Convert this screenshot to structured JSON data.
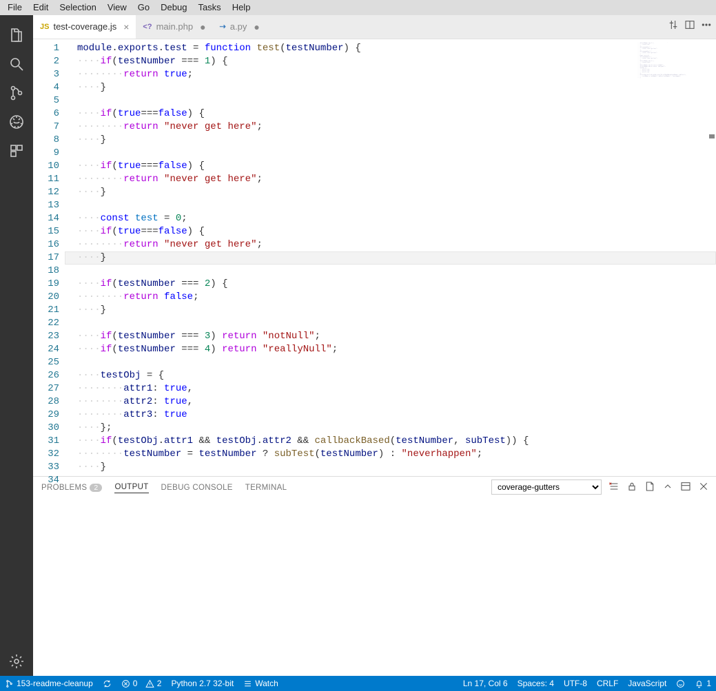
{
  "menu": {
    "items": [
      "File",
      "Edit",
      "Selection",
      "View",
      "Go",
      "Debug",
      "Tasks",
      "Help"
    ]
  },
  "tabs": [
    {
      "icon": "JS",
      "iconClass": "js",
      "label": "test-coverage.js",
      "active": true,
      "dirty": false
    },
    {
      "icon": "<?",
      "iconClass": "php",
      "label": "main.php",
      "active": false,
      "dirty": true
    },
    {
      "icon": "⇢",
      "iconClass": "py",
      "label": "a.py",
      "active": false,
      "dirty": true
    }
  ],
  "cursor_line": 17,
  "code_lines": [
    [
      {
        "t": "var",
        "s": "module"
      },
      {
        "t": "p",
        "s": "."
      },
      {
        "t": "prop",
        "s": "exports"
      },
      {
        "t": "p",
        "s": "."
      },
      {
        "t": "prop",
        "s": "test"
      },
      {
        "t": "p",
        "s": " = "
      },
      {
        "t": "kw",
        "s": "function"
      },
      {
        "t": "p",
        "s": " "
      },
      {
        "t": "fn",
        "s": "test"
      },
      {
        "t": "p",
        "s": "("
      },
      {
        "t": "var",
        "s": "testNumber"
      },
      {
        "t": "p",
        "s": ") {"
      }
    ],
    [
      {
        "t": "ws",
        "s": "····"
      },
      {
        "t": "kw2",
        "s": "if"
      },
      {
        "t": "p",
        "s": "("
      },
      {
        "t": "var",
        "s": "testNumber"
      },
      {
        "t": "p",
        "s": " === "
      },
      {
        "t": "num",
        "s": "1"
      },
      {
        "t": "p",
        "s": ") {"
      }
    ],
    [
      {
        "t": "ws",
        "s": "········"
      },
      {
        "t": "kw2",
        "s": "return"
      },
      {
        "t": "p",
        "s": " "
      },
      {
        "t": "kw",
        "s": "true"
      },
      {
        "t": "p",
        "s": ";"
      }
    ],
    [
      {
        "t": "ws",
        "s": "····"
      },
      {
        "t": "p",
        "s": "}"
      }
    ],
    [],
    [
      {
        "t": "ws",
        "s": "····"
      },
      {
        "t": "kw2",
        "s": "if"
      },
      {
        "t": "p",
        "s": "("
      },
      {
        "t": "kw",
        "s": "true"
      },
      {
        "t": "p",
        "s": "==="
      },
      {
        "t": "kw",
        "s": "false"
      },
      {
        "t": "p",
        "s": ") {"
      }
    ],
    [
      {
        "t": "ws",
        "s": "········"
      },
      {
        "t": "kw2",
        "s": "return"
      },
      {
        "t": "p",
        "s": " "
      },
      {
        "t": "str",
        "s": "\"never get here\""
      },
      {
        "t": "p",
        "s": ";"
      }
    ],
    [
      {
        "t": "ws",
        "s": "····"
      },
      {
        "t": "p",
        "s": "}"
      }
    ],
    [],
    [
      {
        "t": "ws",
        "s": "····"
      },
      {
        "t": "kw2",
        "s": "if"
      },
      {
        "t": "p",
        "s": "("
      },
      {
        "t": "kw",
        "s": "true"
      },
      {
        "t": "p",
        "s": "==="
      },
      {
        "t": "kw",
        "s": "false"
      },
      {
        "t": "p",
        "s": ") {"
      }
    ],
    [
      {
        "t": "ws",
        "s": "········"
      },
      {
        "t": "kw2",
        "s": "return"
      },
      {
        "t": "p",
        "s": " "
      },
      {
        "t": "str",
        "s": "\"never get here\""
      },
      {
        "t": "p",
        "s": ";"
      }
    ],
    [
      {
        "t": "ws",
        "s": "····"
      },
      {
        "t": "p",
        "s": "}"
      }
    ],
    [],
    [
      {
        "t": "ws",
        "s": "····"
      },
      {
        "t": "kw",
        "s": "const"
      },
      {
        "t": "p",
        "s": " "
      },
      {
        "t": "const",
        "s": "test"
      },
      {
        "t": "p",
        "s": " = "
      },
      {
        "t": "num",
        "s": "0"
      },
      {
        "t": "p",
        "s": ";"
      }
    ],
    [
      {
        "t": "ws",
        "s": "····"
      },
      {
        "t": "kw2",
        "s": "if"
      },
      {
        "t": "p",
        "s": "("
      },
      {
        "t": "kw",
        "s": "true"
      },
      {
        "t": "p",
        "s": "==="
      },
      {
        "t": "kw",
        "s": "false"
      },
      {
        "t": "p",
        "s": ") {"
      }
    ],
    [
      {
        "t": "ws",
        "s": "········"
      },
      {
        "t": "kw2",
        "s": "return"
      },
      {
        "t": "p",
        "s": " "
      },
      {
        "t": "str",
        "s": "\"never get here\""
      },
      {
        "t": "p",
        "s": ";"
      }
    ],
    [
      {
        "t": "ws",
        "s": "····"
      },
      {
        "t": "p",
        "s": "}"
      }
    ],
    [],
    [
      {
        "t": "ws",
        "s": "····"
      },
      {
        "t": "kw2",
        "s": "if"
      },
      {
        "t": "p",
        "s": "("
      },
      {
        "t": "var",
        "s": "testNumber"
      },
      {
        "t": "p",
        "s": " === "
      },
      {
        "t": "num",
        "s": "2"
      },
      {
        "t": "p",
        "s": ") {"
      }
    ],
    [
      {
        "t": "ws",
        "s": "········"
      },
      {
        "t": "kw2",
        "s": "return"
      },
      {
        "t": "p",
        "s": " "
      },
      {
        "t": "kw",
        "s": "false"
      },
      {
        "t": "p",
        "s": ";"
      }
    ],
    [
      {
        "t": "ws",
        "s": "····"
      },
      {
        "t": "p",
        "s": "}"
      }
    ],
    [],
    [
      {
        "t": "ws",
        "s": "····"
      },
      {
        "t": "kw2",
        "s": "if"
      },
      {
        "t": "p",
        "s": "("
      },
      {
        "t": "var",
        "s": "testNumber"
      },
      {
        "t": "p",
        "s": " === "
      },
      {
        "t": "num",
        "s": "3"
      },
      {
        "t": "p",
        "s": ") "
      },
      {
        "t": "kw2",
        "s": "return"
      },
      {
        "t": "p",
        "s": " "
      },
      {
        "t": "str",
        "s": "\"notNull\""
      },
      {
        "t": "p",
        "s": ";"
      }
    ],
    [
      {
        "t": "ws",
        "s": "····"
      },
      {
        "t": "kw2",
        "s": "if"
      },
      {
        "t": "p",
        "s": "("
      },
      {
        "t": "var",
        "s": "testNumber"
      },
      {
        "t": "p",
        "s": " === "
      },
      {
        "t": "num",
        "s": "4"
      },
      {
        "t": "p",
        "s": ") "
      },
      {
        "t": "kw2",
        "s": "return"
      },
      {
        "t": "p",
        "s": " "
      },
      {
        "t": "str",
        "s": "\"reallyNull\""
      },
      {
        "t": "p",
        "s": ";"
      }
    ],
    [],
    [
      {
        "t": "ws",
        "s": "····"
      },
      {
        "t": "var",
        "s": "testObj"
      },
      {
        "t": "p",
        "s": " = {"
      }
    ],
    [
      {
        "t": "ws",
        "s": "········"
      },
      {
        "t": "prop",
        "s": "attr1"
      },
      {
        "t": "p",
        "s": ": "
      },
      {
        "t": "kw",
        "s": "true"
      },
      {
        "t": "p",
        "s": ","
      }
    ],
    [
      {
        "t": "ws",
        "s": "········"
      },
      {
        "t": "prop",
        "s": "attr2"
      },
      {
        "t": "p",
        "s": ": "
      },
      {
        "t": "kw",
        "s": "true"
      },
      {
        "t": "p",
        "s": ","
      }
    ],
    [
      {
        "t": "ws",
        "s": "········"
      },
      {
        "t": "prop",
        "s": "attr3"
      },
      {
        "t": "p",
        "s": ": "
      },
      {
        "t": "kw",
        "s": "true"
      }
    ],
    [
      {
        "t": "ws",
        "s": "····"
      },
      {
        "t": "p",
        "s": "};"
      }
    ],
    [
      {
        "t": "ws",
        "s": "····"
      },
      {
        "t": "kw2",
        "s": "if"
      },
      {
        "t": "p",
        "s": "("
      },
      {
        "t": "var",
        "s": "testObj"
      },
      {
        "t": "p",
        "s": "."
      },
      {
        "t": "prop",
        "s": "attr1"
      },
      {
        "t": "p",
        "s": " && "
      },
      {
        "t": "var",
        "s": "testObj"
      },
      {
        "t": "p",
        "s": "."
      },
      {
        "t": "prop",
        "s": "attr2"
      },
      {
        "t": "p",
        "s": " && "
      },
      {
        "t": "fn",
        "s": "callbackBased"
      },
      {
        "t": "p",
        "s": "("
      },
      {
        "t": "var",
        "s": "testNumber"
      },
      {
        "t": "p",
        "s": ", "
      },
      {
        "t": "var",
        "s": "subTest"
      },
      {
        "t": "p",
        "s": ")) {"
      }
    ],
    [
      {
        "t": "ws",
        "s": "········"
      },
      {
        "t": "var",
        "s": "testNumber"
      },
      {
        "t": "p",
        "s": " = "
      },
      {
        "t": "var",
        "s": "testNumber"
      },
      {
        "t": "p",
        "s": " ? "
      },
      {
        "t": "fn",
        "s": "subTest"
      },
      {
        "t": "p",
        "s": "("
      },
      {
        "t": "var",
        "s": "testNumber"
      },
      {
        "t": "p",
        "s": ") : "
      },
      {
        "t": "str",
        "s": "\"neverhappen\""
      },
      {
        "t": "p",
        "s": ";"
      }
    ],
    [
      {
        "t": "ws",
        "s": "····"
      },
      {
        "t": "p",
        "s": "}"
      }
    ],
    []
  ],
  "panel": {
    "tabs": {
      "problems": "PROBLEMS",
      "problems_count": "2",
      "output": "OUTPUT",
      "debug": "DEBUG CONSOLE",
      "terminal": "TERMINAL"
    },
    "output_channel": "coverage-gutters"
  },
  "status": {
    "branch": "153-readme-cleanup",
    "errors": "0",
    "warnings": "2",
    "python": "Python 2.7 32-bit",
    "watch": "Watch",
    "lncol": "Ln 17, Col 6",
    "spaces": "Spaces: 4",
    "encoding": "UTF-8",
    "eol": "CRLF",
    "lang": "JavaScript",
    "bell": "1"
  }
}
